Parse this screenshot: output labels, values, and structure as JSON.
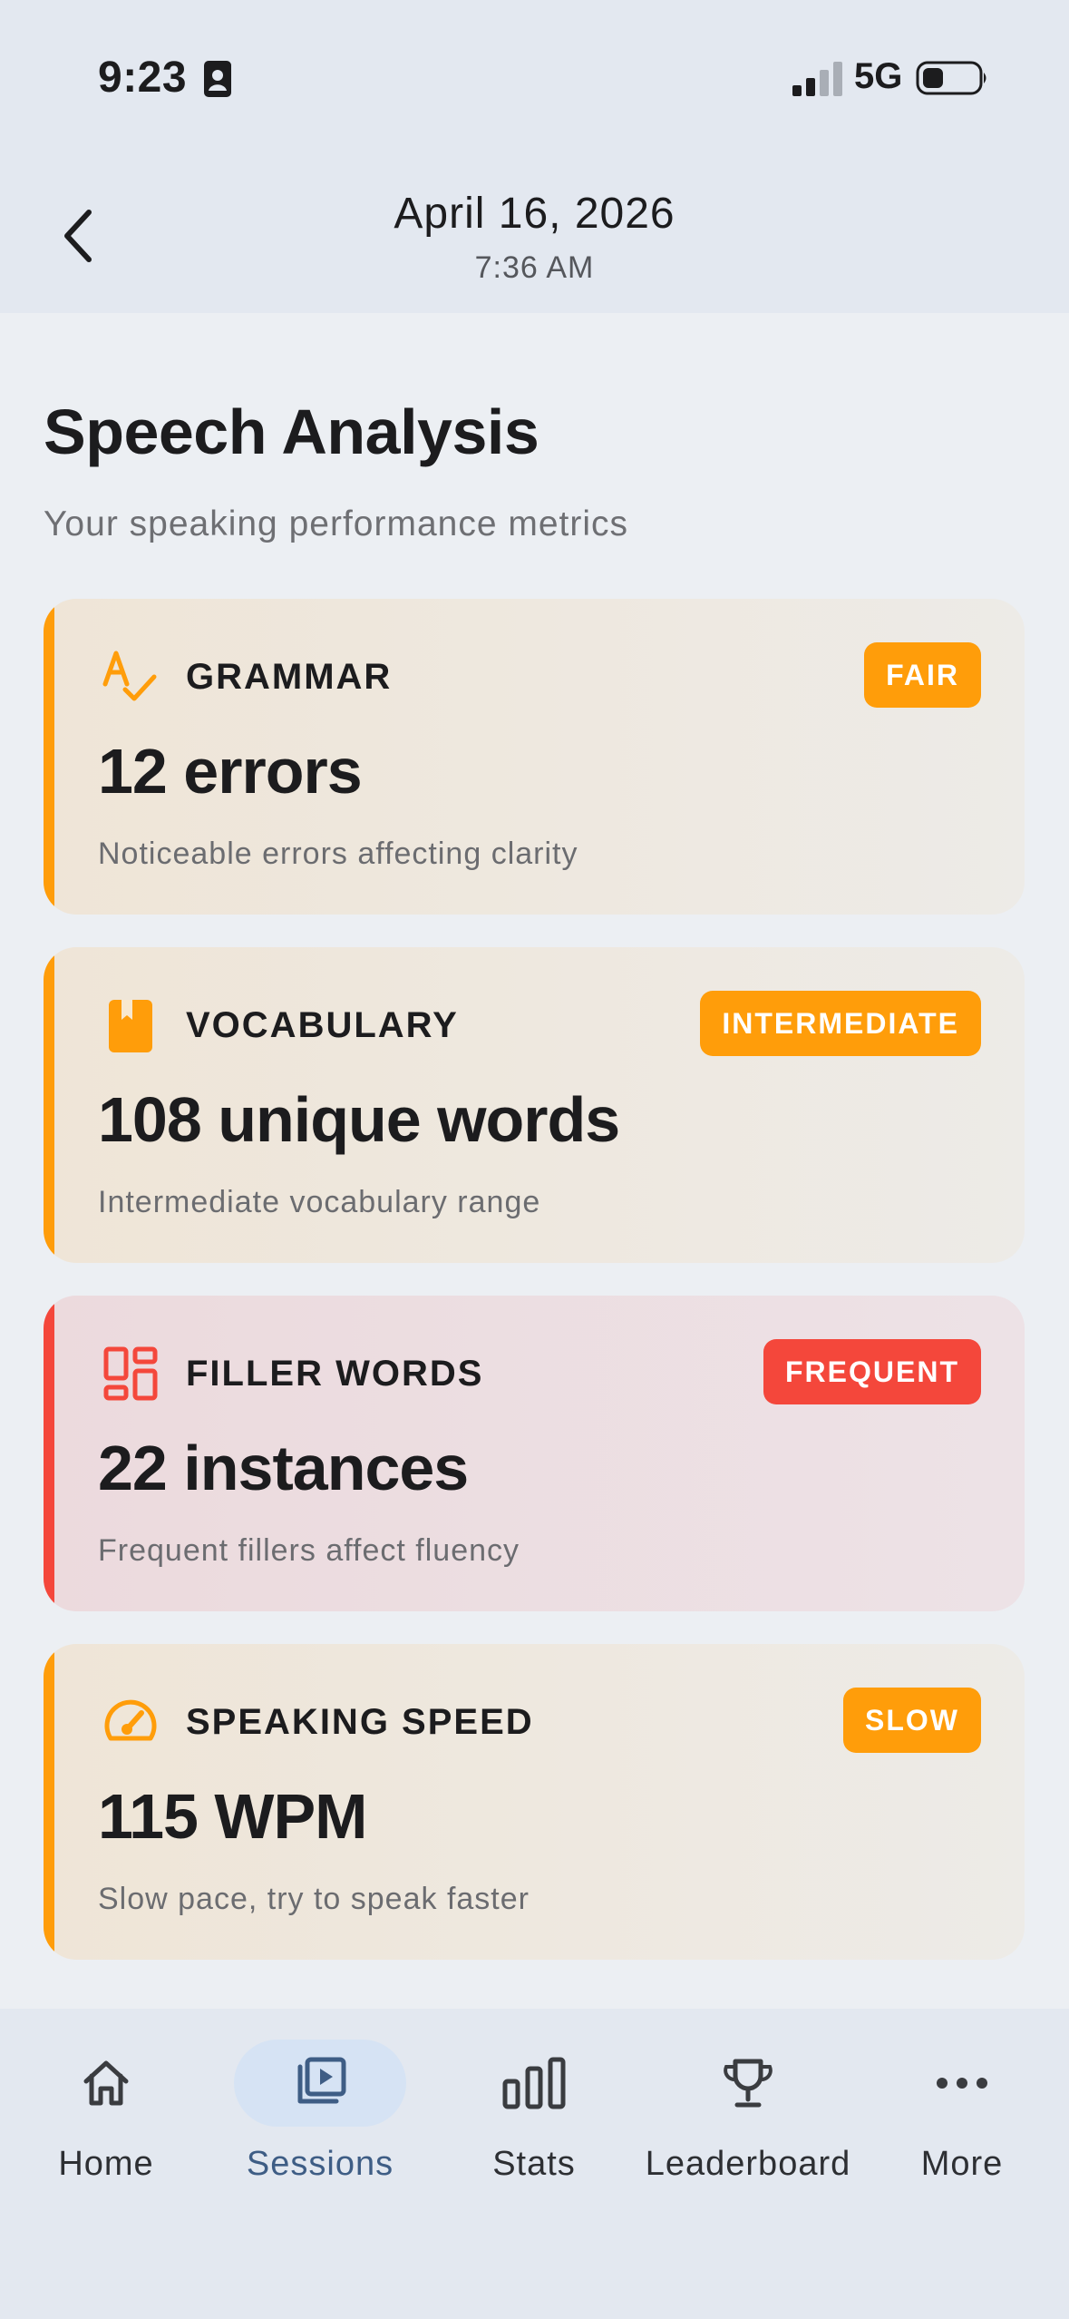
{
  "status_bar": {
    "time": "9:23",
    "network": "5G"
  },
  "header": {
    "title": "April 16, 2026",
    "subtitle": "7:36 AM"
  },
  "main": {
    "title": "Speech Analysis",
    "subtitle": "Your speaking performance metrics",
    "cards": [
      {
        "label": "GRAMMAR",
        "badge": "FAIR",
        "value": "12 errors",
        "description": "Noticeable errors affecting clarity",
        "icon": "spellcheck-icon",
        "accent": "#ff9d0a"
      },
      {
        "label": "VOCABULARY",
        "badge": "INTERMEDIATE",
        "value": "108 unique words",
        "description": "Intermediate vocabulary range",
        "icon": "book-icon",
        "accent": "#ff9d0a"
      },
      {
        "label": "FILLER WORDS",
        "badge": "FREQUENT",
        "value": "22 instances",
        "description": "Frequent fillers affect fluency",
        "icon": "dashboard-icon",
        "accent": "#f4473b"
      },
      {
        "label": "SPEAKING SPEED",
        "badge": "SLOW",
        "value": "115 WPM",
        "description": "Slow pace, try to speak faster",
        "icon": "speedometer-icon",
        "accent": "#ff9d0a"
      }
    ]
  },
  "tabbar": {
    "items": [
      {
        "label": "Home",
        "icon": "home-icon",
        "active": false
      },
      {
        "label": "Sessions",
        "icon": "sessions-icon",
        "active": true
      },
      {
        "label": "Stats",
        "icon": "stats-icon",
        "active": false
      },
      {
        "label": "Leaderboard",
        "icon": "trophy-icon",
        "active": false
      },
      {
        "label": "More",
        "icon": "more-icon",
        "active": false
      }
    ]
  }
}
